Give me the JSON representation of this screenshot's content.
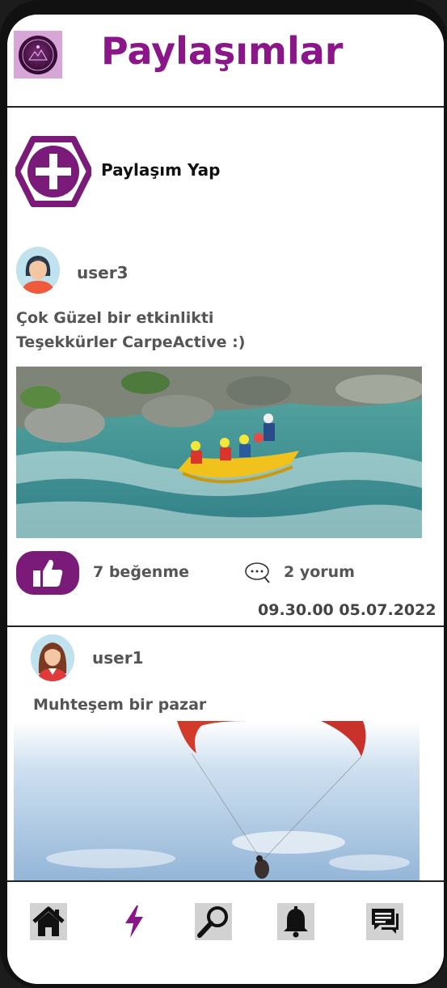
{
  "header": {
    "title": "Paylaşımlar",
    "logo_icon": "carpe-active-logo"
  },
  "create_post": {
    "icon": "plus-circle-icon",
    "label": "Paylaşım Yap"
  },
  "posts": [
    {
      "username": "user3",
      "avatar": "female-avatar-short-hair",
      "text_lines": [
        "Çok Güzel bir etkinlikti",
        "Teşekkürler CarpeActive :)"
      ],
      "image": "white-water-rafting-photo",
      "likes_text": "7 beğenme",
      "comments_text": "2 yorum",
      "timestamp": "09.30.00 05.07.2022"
    },
    {
      "username": "user1",
      "avatar": "female-avatar-long-hair",
      "text_lines": [
        "Muhteşem bir pazar"
      ],
      "image": "paragliding-photo"
    }
  ],
  "navbar": {
    "items": [
      {
        "icon": "home-icon"
      },
      {
        "icon": "lightning-icon",
        "active": true
      },
      {
        "icon": "search-icon"
      },
      {
        "icon": "bell-icon"
      },
      {
        "icon": "chat-icon"
      }
    ]
  },
  "colors": {
    "accent": "#8a168a",
    "like_button": "#7a1b7a",
    "text": "#555555"
  }
}
